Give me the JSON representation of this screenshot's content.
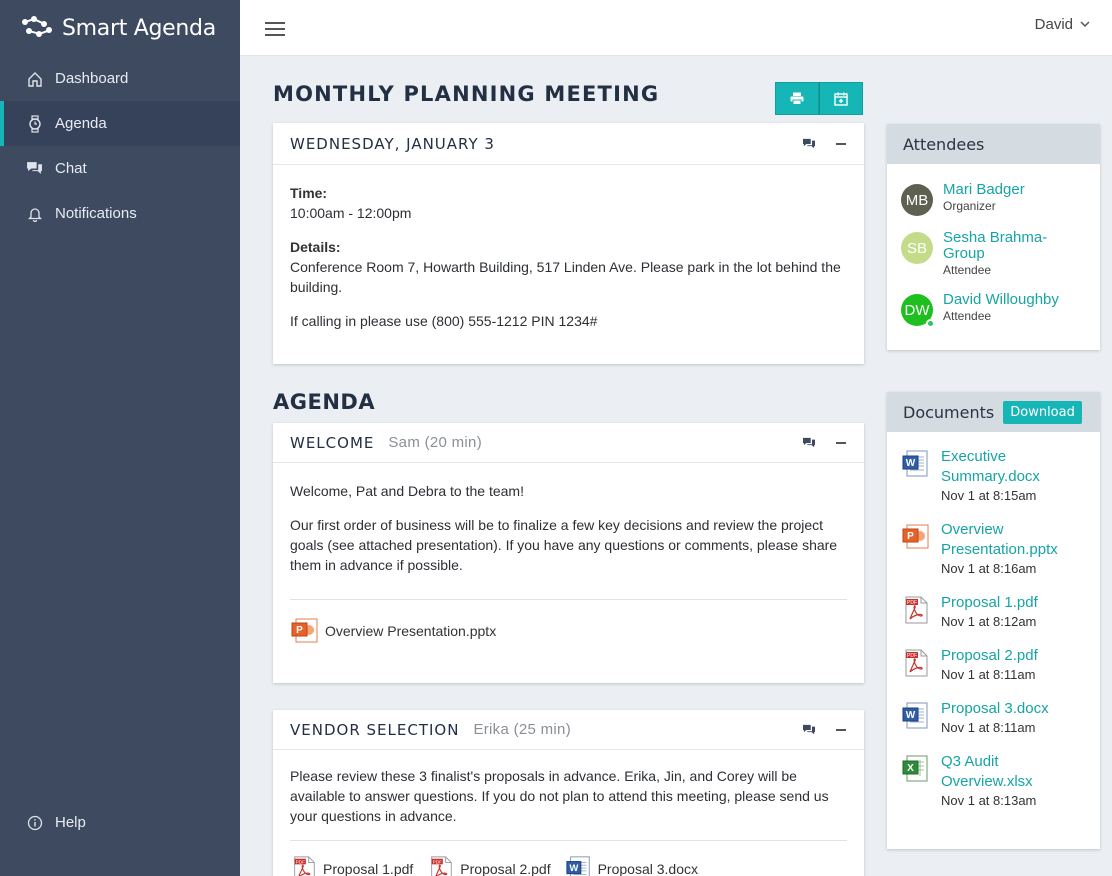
{
  "app": {
    "title": "Smart Agenda"
  },
  "sidebar": {
    "items": [
      {
        "label": "Dashboard",
        "icon": "home-icon"
      },
      {
        "label": "Agenda",
        "icon": "watch-icon",
        "active": true
      },
      {
        "label": "Chat",
        "icon": "chat-icon"
      },
      {
        "label": "Notifications",
        "icon": "bell-icon"
      }
    ],
    "help": {
      "label": "Help",
      "icon": "info-icon"
    }
  },
  "topbar": {
    "user": "David"
  },
  "meeting": {
    "title": "MONTHLY PLANNING MEETING",
    "date": "WEDNESDAY, JANUARY 3",
    "time_label": "Time:",
    "time": "10:00am - 12:00pm",
    "details_label": "Details:",
    "details": "Conference Room 7, Howarth Building,  517 Linden Ave. Please park in the lot behind the building.",
    "calling": "If calling in please use  (800) 555-1212 PIN 1234#"
  },
  "agenda": {
    "title": "AGENDA",
    "items": [
      {
        "title": "WELCOME",
        "presenter": "Sam (20 min)",
        "paragraphs": [
          "Welcome, Pat and Debra to the team!",
          "Our first order of business will be to finalize a few key decisions and review the project goals (see attached presentation). If you have any questions or comments, please share them in advance if possible."
        ],
        "attachments": [
          {
            "name": "Overview Presentation.pptx",
            "type": "pptx"
          }
        ]
      },
      {
        "title": "VENDOR SELECTION",
        "presenter": "Erika (25 min)",
        "paragraphs": [
          "Please review these 3 finalist's proposals in advance. Erika, Jin, and Corey will be available to answer questions. If you do not plan to attend this meeting, please send us your questions in advance."
        ],
        "attachments": [
          {
            "name": "Proposal 1.pdf",
            "type": "pdf"
          },
          {
            "name": "Proposal 2.pdf",
            "type": "pdf"
          },
          {
            "name": "Proposal 3.docx",
            "type": "docx"
          }
        ]
      }
    ]
  },
  "attendees": {
    "title": "Attendees",
    "people": [
      {
        "initials": "MB",
        "name": "Mari Badger",
        "role": "Organizer",
        "color": "#5e6150"
      },
      {
        "initials": "SB",
        "name": "Sesha Brahma-Group",
        "role": "Attendee",
        "color": "#c4dc8a"
      },
      {
        "initials": "DW",
        "name": "David Willoughby",
        "role": "Attendee",
        "color": "#1fbf1f",
        "online": true
      }
    ]
  },
  "documents": {
    "title": "Documents",
    "download_label": "Download",
    "files": [
      {
        "name": "Executive Summary.docx",
        "date": "Nov 1 at 8:15am",
        "type": "docx"
      },
      {
        "name": "Overview Presentation.pptx",
        "date": "Nov 1 at 8:16am",
        "type": "pptx"
      },
      {
        "name": "Proposal 1.pdf",
        "date": "Nov 1 at 8:12am",
        "type": "pdf"
      },
      {
        "name": "Proposal 2.pdf",
        "date": "Nov 1 at 8:11am",
        "type": "pdf"
      },
      {
        "name": "Proposal 3.docx",
        "date": "Nov 1 at 8:11am",
        "type": "docx"
      },
      {
        "name": "Q3 Audit Overview.xlsx",
        "date": "Nov 1 at 8:13am",
        "type": "xlsx"
      }
    ]
  },
  "colors": {
    "accent": "#17b6b6",
    "sidebar": "#3d4a60",
    "link": "#17a4a6"
  }
}
